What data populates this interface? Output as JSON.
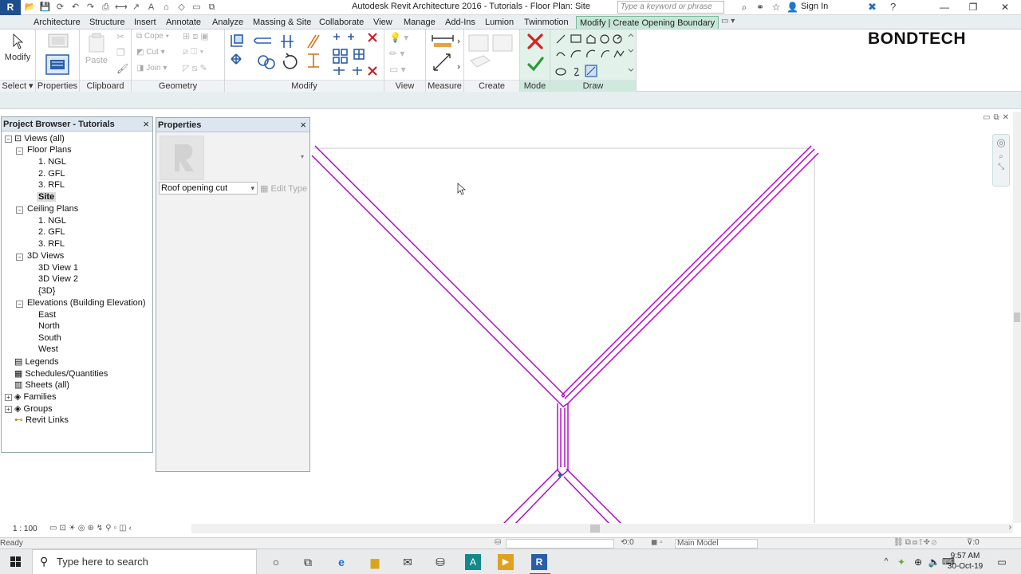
{
  "title_bar": {
    "app_button": "R",
    "title": "Autodesk Revit Architecture 2016 -     Tutorials - Floor Plan: Site",
    "search_placeholder": "Type a keyword or phrase",
    "sign_in": "Sign In",
    "minimize": "—",
    "maximize": "❐",
    "close": "✕"
  },
  "tabs": [
    {
      "label": "Architecture"
    },
    {
      "label": "Structure"
    },
    {
      "label": "Insert"
    },
    {
      "label": "Annotate"
    },
    {
      "label": "Analyze"
    },
    {
      "label": "Massing & Site"
    },
    {
      "label": "Collaborate"
    },
    {
      "label": "View"
    },
    {
      "label": "Manage"
    },
    {
      "label": "Add-Ins"
    },
    {
      "label": "Lumion"
    },
    {
      "label": "Twinmotion"
    },
    {
      "label": "Modify | Create Opening Boundary"
    }
  ],
  "ribbon": {
    "modify_label": "Modify",
    "select_label": "Select ▾",
    "properties_label": "Properties",
    "clipboard_label": "Clipboard",
    "paste_label": "Paste",
    "geometry_label": "Geometry",
    "cope_label": "Cope ▾",
    "cut_label": "Cut ▾",
    "join_label": "Join ▾",
    "modify_panel_label": "Modify",
    "view_label": "View",
    "measure_label": "Measure",
    "create_label": "Create",
    "mode_label": "Mode",
    "draw_label": "Draw",
    "brand": "BONDTECH"
  },
  "project_browser": {
    "title": "Project Browser - Tutorials",
    "close": "×",
    "nodes": [
      {
        "label": "Views (all)"
      },
      {
        "label": "Floor Plans"
      },
      {
        "label": "1. NGL"
      },
      {
        "label": "2. GFL"
      },
      {
        "label": "3. RFL"
      },
      {
        "label": "Site"
      },
      {
        "label": "Ceiling Plans"
      },
      {
        "label": "1. NGL"
      },
      {
        "label": "2. GFL"
      },
      {
        "label": "3. RFL"
      },
      {
        "label": "3D Views"
      },
      {
        "label": "3D View 1"
      },
      {
        "label": "3D View 2"
      },
      {
        "label": "{3D}"
      },
      {
        "label": "Elevations (Building Elevation)"
      },
      {
        "label": "East"
      },
      {
        "label": "North"
      },
      {
        "label": "South"
      },
      {
        "label": "West"
      },
      {
        "label": "Legends"
      },
      {
        "label": "Schedules/Quantities"
      },
      {
        "label": "Sheets (all)"
      },
      {
        "label": "Families"
      },
      {
        "label": "Groups"
      },
      {
        "label": "Revit Links"
      }
    ]
  },
  "properties": {
    "title": "Properties",
    "close": "×",
    "type_selector": "Roof opening cut",
    "edit_type": "Edit Type"
  },
  "view_bar": {
    "scale": "1 : 100"
  },
  "status_bar": {
    "text": "Ready",
    "selection_count": ":0",
    "model": "Main Model",
    "filter_count": ":0"
  },
  "taskbar": {
    "search_placeholder": "Type here to search",
    "time": "9:57 AM",
    "date": "30-Oct-19"
  },
  "colors": {
    "sketch_line": "#b000c8",
    "context_tab": "#c6e6d8",
    "accent": "#1f4e8c"
  }
}
